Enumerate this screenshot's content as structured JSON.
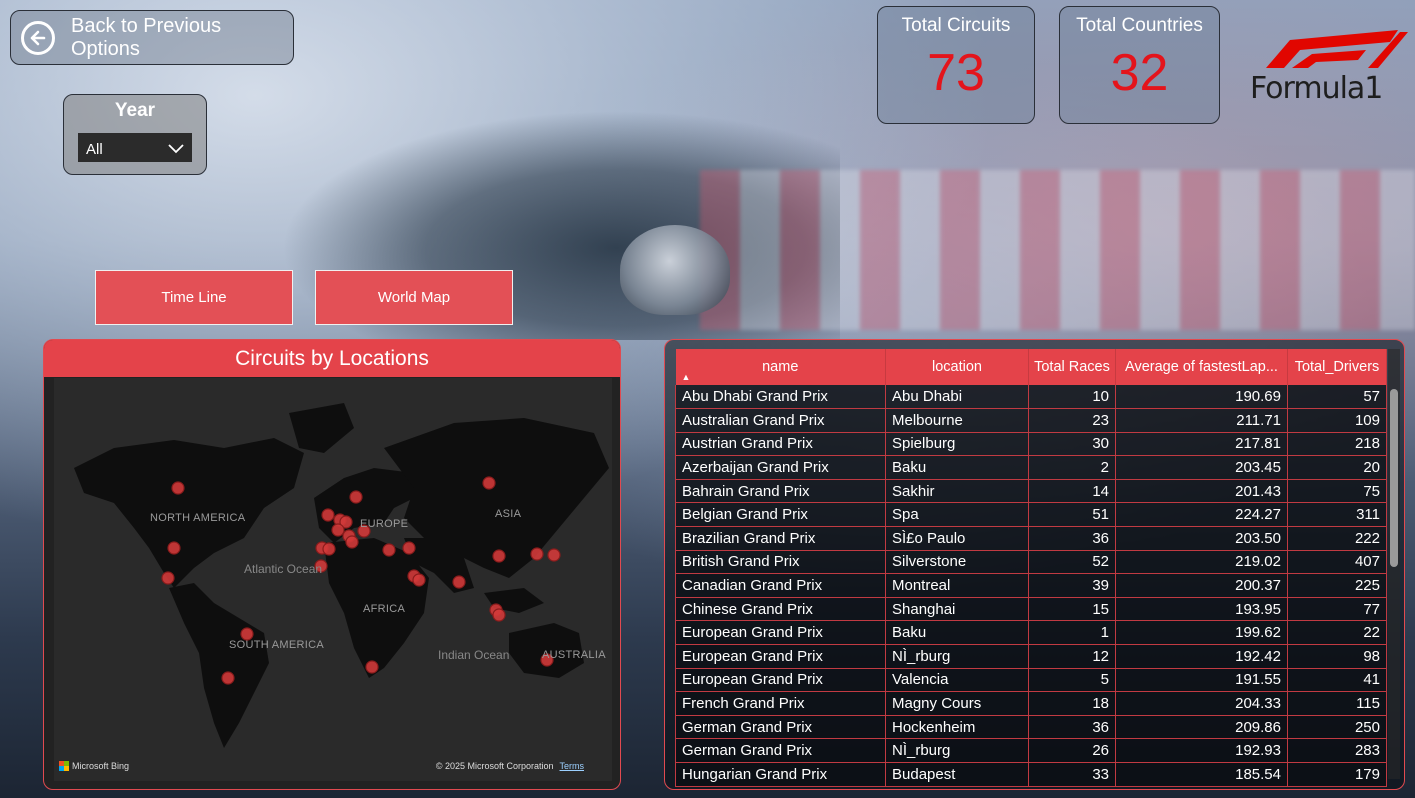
{
  "back_button": {
    "label": "Back to Previous Options"
  },
  "year_filter": {
    "title": "Year",
    "selected": "All"
  },
  "kpis": [
    {
      "label": "Total Circuits",
      "value": "73"
    },
    {
      "label": "Total Countries",
      "value": "32"
    }
  ],
  "brand": {
    "logo_text": "FORMULA 1",
    "accent": "#e10600"
  },
  "nav": {
    "timeline": "Time Line",
    "world_map": "World Map"
  },
  "map": {
    "title": "Circuits by Locations",
    "labels": {
      "north_america": "NORTH AMERICA",
      "europe": "EUROPE",
      "asia": "ASIA",
      "atlantic": "Atlantic Ocean",
      "africa": "AFRICA",
      "south_america": "SOUTH AMERICA",
      "indian": "Indian Ocean",
      "australia": "AUSTRALIA"
    },
    "attribution": "Microsoft Bing",
    "copyright": "© 2025 Microsoft Corporation",
    "terms": "Terms"
  },
  "table": {
    "headers": [
      "name",
      "location",
      "Total Races",
      "Average of fastestLap...",
      "Total_Drivers"
    ],
    "rows": [
      [
        "Abu Dhabi Grand Prix",
        "Abu Dhabi",
        "10",
        "190.69",
        "57"
      ],
      [
        "Australian Grand Prix",
        "Melbourne",
        "23",
        "211.71",
        "109"
      ],
      [
        "Austrian Grand Prix",
        "Spielburg",
        "30",
        "217.81",
        "218"
      ],
      [
        "Azerbaijan Grand Prix",
        "Baku",
        "2",
        "203.45",
        "20"
      ],
      [
        "Bahrain Grand Prix",
        "Sakhir",
        "14",
        "201.43",
        "75"
      ],
      [
        "Belgian Grand Prix",
        "Spa",
        "51",
        "224.27",
        "311"
      ],
      [
        "Brazilian Grand Prix",
        "SÌ£o Paulo",
        "36",
        "203.50",
        "222"
      ],
      [
        "British Grand Prix",
        "Silverstone",
        "52",
        "219.02",
        "407"
      ],
      [
        "Canadian Grand Prix",
        "Montreal",
        "39",
        "200.37",
        "225"
      ],
      [
        "Chinese Grand Prix",
        "Shanghai",
        "15",
        "193.95",
        "77"
      ],
      [
        "European Grand Prix",
        "Baku",
        "1",
        "199.62",
        "22"
      ],
      [
        "European Grand Prix",
        "NÌ_rburg",
        "12",
        "192.42",
        "98"
      ],
      [
        "European Grand Prix",
        "Valencia",
        "5",
        "191.55",
        "41"
      ],
      [
        "French Grand Prix",
        "Magny Cours",
        "18",
        "204.33",
        "115"
      ],
      [
        "German Grand Prix",
        "Hockenheim",
        "36",
        "209.86",
        "250"
      ],
      [
        "German Grand Prix",
        "NÌ_rburg",
        "26",
        "192.93",
        "283"
      ],
      [
        "Hungarian Grand Prix",
        "Budapest",
        "33",
        "185.54",
        "179"
      ]
    ]
  }
}
